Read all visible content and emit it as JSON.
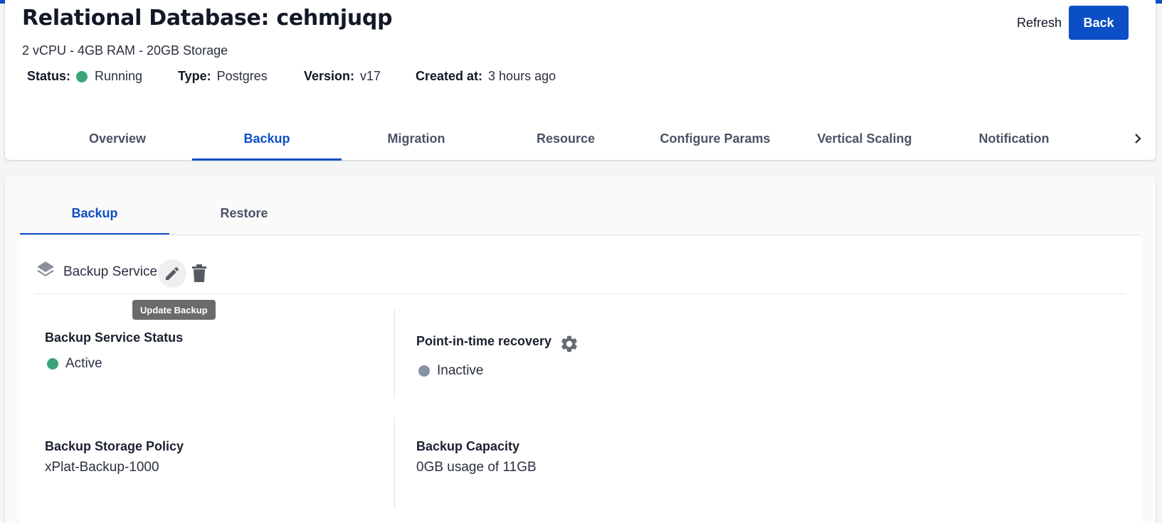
{
  "header": {
    "title": "Relational Database: cehmjuqp",
    "subtitle": "2 vCPU - 4GB RAM - 20GB Storage",
    "refresh_label": "Refresh",
    "back_label": "Back",
    "meta": {
      "status_key": "Status:",
      "status_value": "Running",
      "type_key": "Type:",
      "type_value": "Postgres",
      "version_key": "Version:",
      "version_value": "v17",
      "created_key": "Created at:",
      "created_value": "3 hours ago"
    }
  },
  "tabs": [
    {
      "label": "Overview"
    },
    {
      "label": "Backup"
    },
    {
      "label": "Migration"
    },
    {
      "label": "Resource"
    },
    {
      "label": "Configure Params"
    },
    {
      "label": "Vertical Scaling"
    },
    {
      "label": "Notification"
    }
  ],
  "subtabs": [
    {
      "label": "Backup"
    },
    {
      "label": "Restore"
    }
  ],
  "backup_service": {
    "title": "Backup Service",
    "tooltip": "Update Backup",
    "status_label": "Backup Service Status",
    "status_value": "Active",
    "pitr_label": "Point-in-time recovery",
    "pitr_value": "Inactive",
    "policy_label": "Backup Storage Policy",
    "policy_value": "xPlat-Backup-1000",
    "capacity_label": "Backup Capacity",
    "capacity_value": "0GB usage of 11GB"
  },
  "colors": {
    "accent": "#0b4fc6",
    "status_active": "#3aa57a",
    "status_inactive": "#8891a3"
  },
  "icons": [
    "chevron-right-icon",
    "layers-icon",
    "pencil-icon",
    "trash-icon",
    "gear-icon"
  ]
}
